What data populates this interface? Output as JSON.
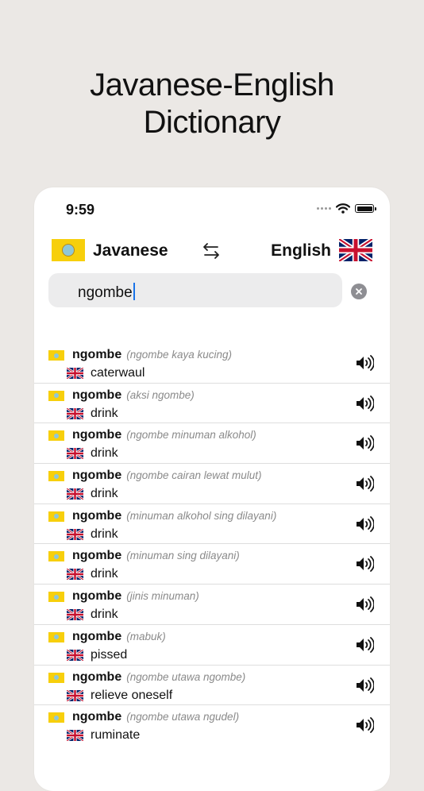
{
  "hero": {
    "line1": "Javanese-English",
    "line2": "Dictionary"
  },
  "status_bar": {
    "time": "9:59"
  },
  "languages": {
    "source": "Javanese",
    "target": "English"
  },
  "search": {
    "value": "ngombe"
  },
  "icons": {
    "swap": "swap-arrows-icon",
    "clear": "clear-circle-icon",
    "speaker": "speaker-icon",
    "wifi": "wifi-icon",
    "battery": "battery-icon",
    "flag_source": "javanese-flag-icon",
    "flag_target": "uk-flag-icon"
  },
  "colors": {
    "flag_yellow": "#f7cf0c",
    "caret": "#1a73e8",
    "background": "#ebe8e5"
  },
  "results": [
    {
      "word": "ngombe",
      "context": "(ngombe kaya kucing)",
      "translation": "caterwaul"
    },
    {
      "word": "ngombe",
      "context": "(aksi ngombe)",
      "translation": "drink"
    },
    {
      "word": "ngombe",
      "context": "(ngombe minuman alkohol)",
      "translation": "drink"
    },
    {
      "word": "ngombe",
      "context": "(ngombe cairan lewat mulut)",
      "translation": "drink"
    },
    {
      "word": "ngombe",
      "context": "(minuman alkohol sing dilayani)",
      "translation": "drink"
    },
    {
      "word": "ngombe",
      "context": "(minuman sing dilayani)",
      "translation": "drink"
    },
    {
      "word": "ngombe",
      "context": "(jinis minuman)",
      "translation": "drink"
    },
    {
      "word": "ngombe",
      "context": "(mabuk)",
      "translation": "pissed"
    },
    {
      "word": "ngombe",
      "context": "(ngombe utawa ngombe)",
      "translation": "relieve oneself"
    },
    {
      "word": "ngombe",
      "context": "(ngombe utawa ngudel)",
      "translation": "ruminate"
    }
  ]
}
